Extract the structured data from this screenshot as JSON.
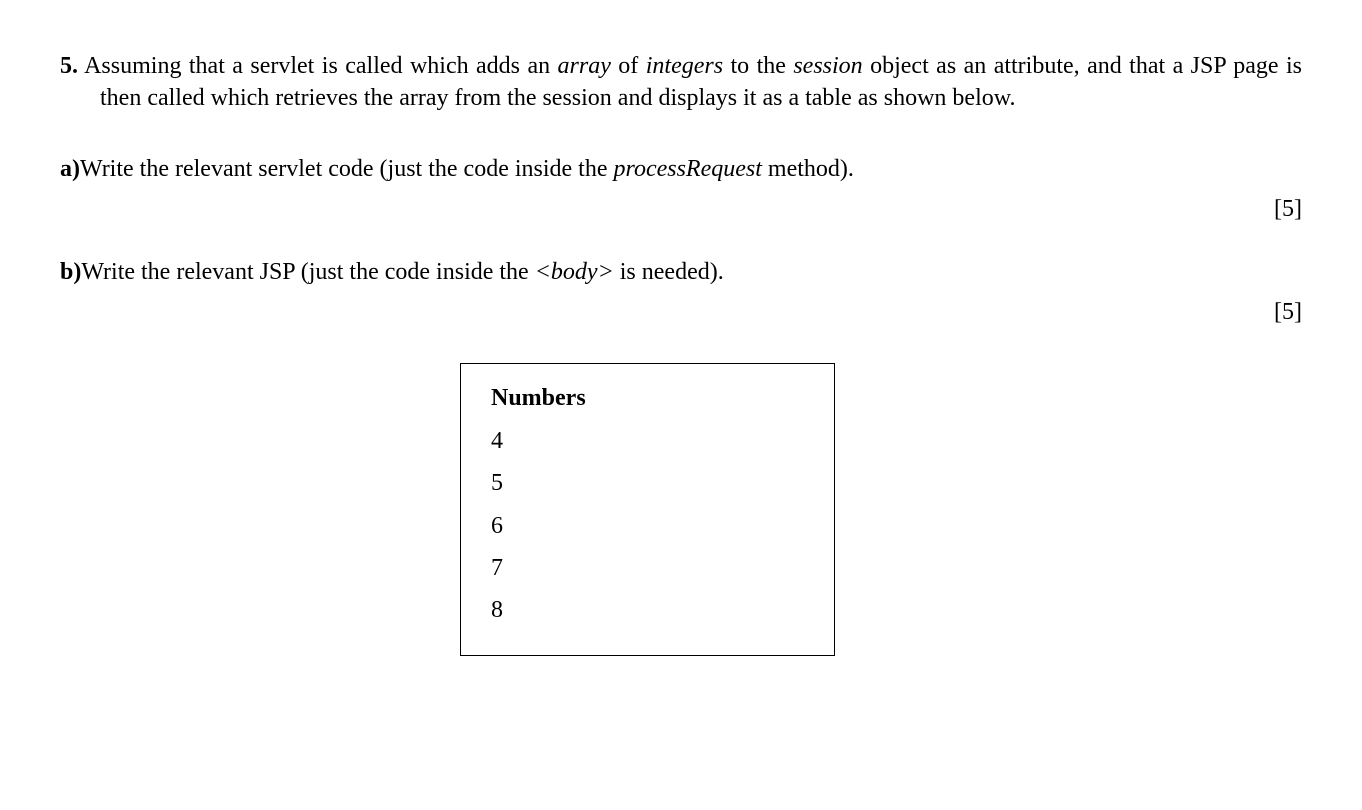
{
  "question": {
    "number": "5.",
    "intro_line1_prefix": " Assuming that a servlet is called which adds an ",
    "intro_italic1": "array",
    "intro_mid1": " of ",
    "intro_italic2": "integers",
    "intro_mid2": " to the ",
    "intro_italic3": "session",
    "intro_line1_suffix": " object as an attribute, and that a JSP page is then called which retrieves the array from the session and displays it as a table as shown below."
  },
  "part_a": {
    "label": "a)",
    "text_before": "Write the relevant servlet code (just the code inside the ",
    "italic": "processRequest",
    "text_after": " method).",
    "marks": "[5]"
  },
  "part_b": {
    "label": "b)",
    "text_before": "Write the relevant JSP (just the code inside the ",
    "italic": "<body>",
    "text_after": " is needed).",
    "marks": "[5]"
  },
  "chart_data": {
    "type": "table",
    "header": "Numbers",
    "values": [
      "4",
      "5",
      "6",
      "7",
      "8"
    ]
  }
}
